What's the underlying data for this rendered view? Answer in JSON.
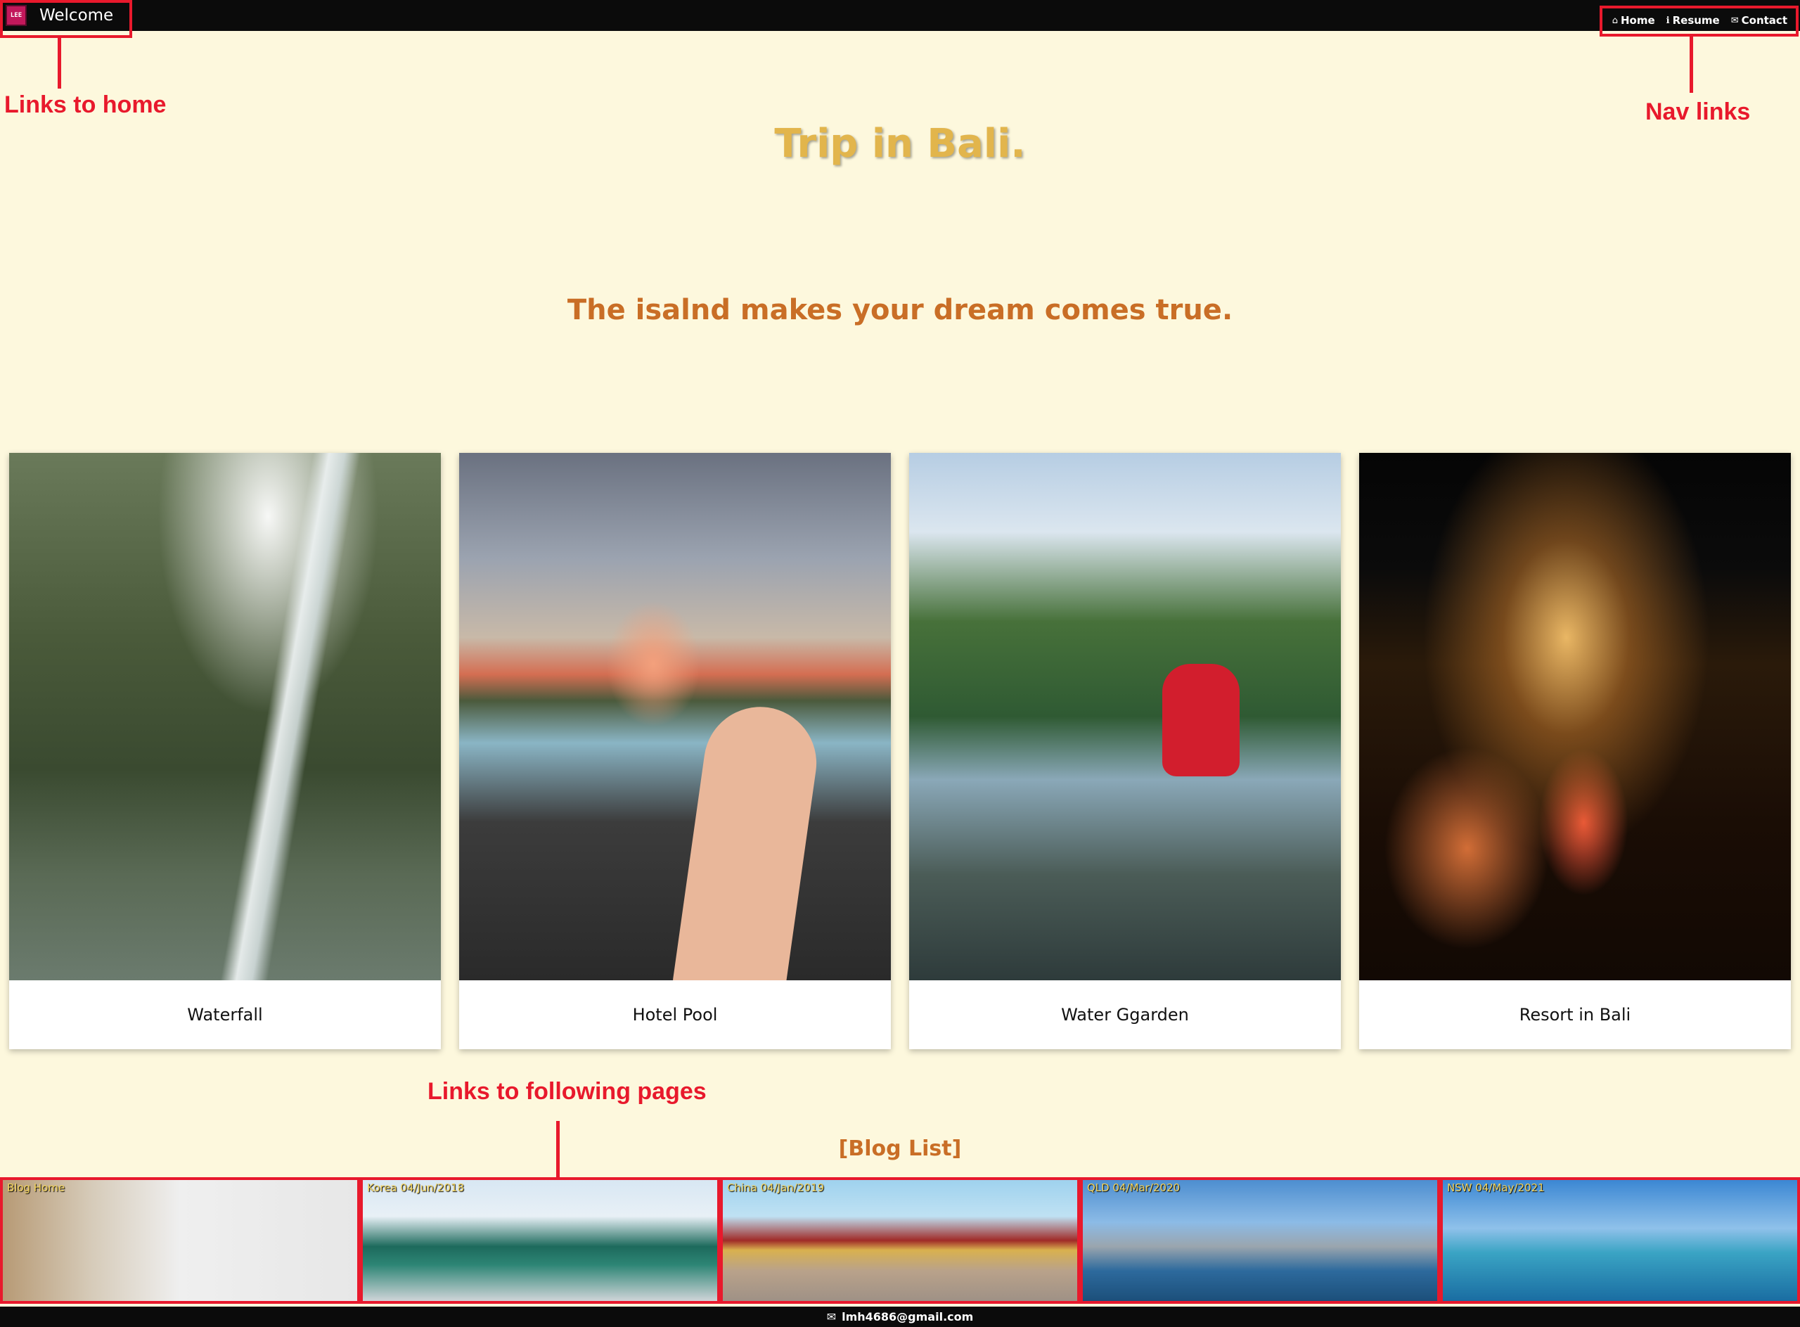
{
  "header": {
    "logo_text": "LEE",
    "brand": "Welcome",
    "nav": [
      {
        "icon": "⌂",
        "label": "Home"
      },
      {
        "icon": "ℹ",
        "label": "Resume"
      },
      {
        "icon": "✉",
        "label": "Contact"
      }
    ]
  },
  "annotations": {
    "home": "Links to home",
    "nav": "Nav links",
    "pages": "Links to following pages"
  },
  "hero": {
    "title": "Trip in Bali.",
    "subtitle": "The isalnd makes your dream comes true."
  },
  "cards": [
    {
      "caption": "Waterfall"
    },
    {
      "caption": "Hotel Pool"
    },
    {
      "caption": "Water Ggarden"
    },
    {
      "caption": "Resort in Bali"
    }
  ],
  "blog": {
    "heading": "[Blog List]",
    "items": [
      {
        "label": "Blog Home"
      },
      {
        "label": "Korea 04/Jun/2018"
      },
      {
        "label": "China 04/Jan/2019"
      },
      {
        "label": "QLD 04/Mar/2020"
      },
      {
        "label": "NSW 04/May/2021"
      }
    ]
  },
  "footer": {
    "icon": "✉",
    "email": "lmh4686@gmail.com"
  }
}
